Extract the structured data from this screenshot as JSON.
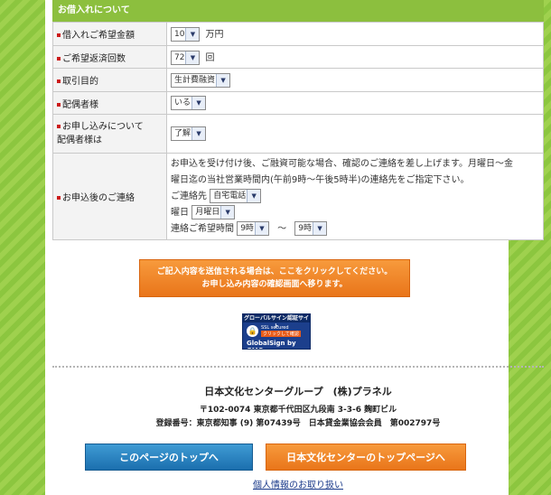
{
  "section": {
    "title": "お借入れについて"
  },
  "rows": {
    "amount": {
      "label": "借入れご希望金額",
      "value": "10",
      "unit": "万円"
    },
    "repayments": {
      "label": "ご希望返済回数",
      "value": "72",
      "unit": "回"
    },
    "purpose": {
      "label": "取引目的",
      "value": "生計費融資"
    },
    "spouse": {
      "label": "配偶者様",
      "value": "いる"
    },
    "spouse_consent": {
      "label_line1": "お申し込みについて",
      "label_line2": "配偶者様は",
      "value": "了解"
    },
    "contact": {
      "label": "お申込後のご連絡",
      "line1": "お申込を受け付け後、ご融資可能な場合、確認のご連絡を差し上げます。月曜日～金",
      "line2": "曜日迄の当社営業時間内(午前9時～午後5時半)の連絡先をご指定下さい。",
      "contact_label": "ご連絡先",
      "contact_value": "自宅電話",
      "day_label": "曜日",
      "day_value": "月曜日",
      "time_label": "連絡ご希望時間",
      "time_from": "9時",
      "time_sep": "～",
      "time_to": "9時"
    }
  },
  "cta": {
    "line1": "ご記入内容を送信される場合は、ここをクリックしてください。",
    "line2": "お申し込み内容の確認画面へ移ります。"
  },
  "seal": {
    "title": "グローバルサイン認証サイト",
    "ssl": "SSL secured",
    "click": "クリックして確認",
    "brand": "GlobalSign by GMO"
  },
  "company": {
    "name": "日本文化センターグループ　(株)プラネル",
    "address": "〒102-0074 東京都千代田区九段南 3-3-6 麹町ビル",
    "registration": "登録番号：東京都知事 (9) 第07439号　日本貸金業協会会員　第002797号"
  },
  "buttons": {
    "page_top": "このページのトップへ",
    "site_top": "日本文化センターのトップページへ"
  },
  "footer": {
    "privacy": "個人情報のお取り扱い"
  },
  "icons": {
    "dropdown": "chevron-down-icon",
    "mark": "red-square-bullet",
    "lock": "lock-icon"
  },
  "colors": {
    "header": "#8cbf3e",
    "cta": "#e9751a",
    "blue_button": "#1b6fae",
    "bullet": "#cc1a1a"
  }
}
